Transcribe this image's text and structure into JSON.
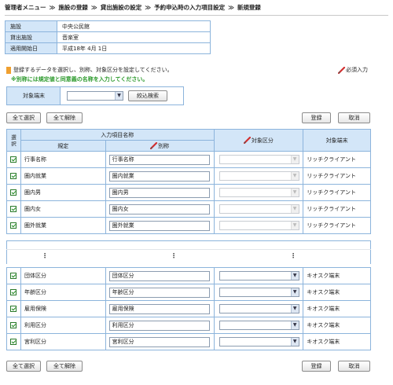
{
  "breadcrumb": [
    "管理者メニュー",
    "施設の登録",
    "貸出施設の設定",
    "予約申込時の入力項目設定",
    "新規登録"
  ],
  "breadcrumb_sep": "≫",
  "info": [
    {
      "label": "施設",
      "value": "中央公民館"
    },
    {
      "label": "貸出施設",
      "value": "音楽室"
    },
    {
      "label": "適用開始日",
      "value": "平成18年 4月 1日"
    }
  ],
  "notes": {
    "line1": "登録するデータを選択し、別称、対象区分を設定してください。",
    "line2": "※別称には規定値と同意義の名称を入力してください。",
    "required": "必須入力"
  },
  "filter": {
    "label": "対象端末",
    "selected": "",
    "search_button": "絞込検索"
  },
  "buttons": {
    "select_all": "全て選択",
    "clear_all": "全て解除",
    "register": "登録",
    "cancel": "取消"
  },
  "table": {
    "col_select": "選択",
    "group_header": "入力項目名称",
    "col_default": "規定",
    "col_alias": "別称",
    "col_category": "対象区分",
    "col_terminal": "対象端末",
    "rows_top": [
      {
        "default": "行事名称",
        "alias": "行事名称",
        "terminal": "リッチクライアント"
      },
      {
        "default": "圏内就業",
        "alias": "圏内就業",
        "terminal": "リッチクライアント"
      },
      {
        "default": "圏内男",
        "alias": "圏内男",
        "terminal": "リッチクライアント"
      },
      {
        "default": "圏内女",
        "alias": "圏内女",
        "terminal": "リッチクライアント"
      },
      {
        "default": "圏外就業",
        "alias": "圏外就業",
        "terminal": "リッチクライアント"
      }
    ],
    "ellipsis": "⋮",
    "rows_bottom": [
      {
        "default": "団体区分",
        "alias": "団体区分",
        "terminal": "キオスク端末"
      },
      {
        "default": "年齢区分",
        "alias": "年齢区分",
        "terminal": "キオスク端末"
      },
      {
        "default": "雇用保険",
        "alias": "雇用保険",
        "terminal": "キオスク端末"
      },
      {
        "default": "利用区分",
        "alias": "利用区分",
        "terminal": "キオスク端末"
      },
      {
        "default": "宮利区分",
        "alias": "宮利区分",
        "terminal": "キオスク端末"
      }
    ]
  },
  "colors": {
    "header_bg": "#d3e6f8",
    "border": "#8cb4dc",
    "note_green": "#2c9a2c",
    "marker_orange": "#f0a030",
    "required_red": "#d23030"
  }
}
